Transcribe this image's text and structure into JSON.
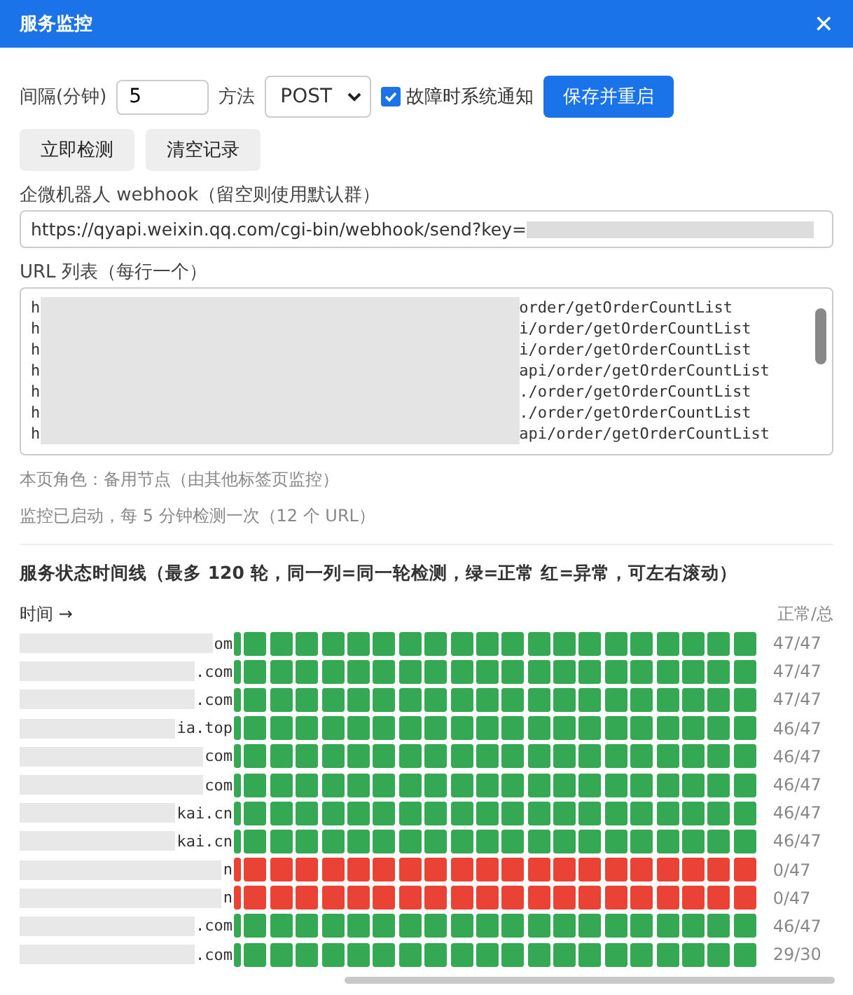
{
  "window": {
    "title": "服务监控",
    "close": "✕"
  },
  "settings": {
    "interval_label": "间隔(分钟)",
    "interval_value": "5",
    "method_label": "方法",
    "method_value": "POST",
    "notify": {
      "label": "故障时系统通知",
      "checked": true
    },
    "save_button": "保存并重启"
  },
  "actions": [
    "立即检测",
    "清空记录"
  ],
  "webhook": {
    "label": "企微机器人 webhook（留空则使用默认群）",
    "value": "https://qyapi.weixin.qq.com/cgi-bin/webhook/send?key="
  },
  "url_list": {
    "label": "URL 列表（每行一个）",
    "lines": [
      {
        "start": "h",
        "end": "order/getOrderCountList"
      },
      {
        "start": "h",
        "end": "i/order/getOrderCountList"
      },
      {
        "start": "h",
        "end": "i/order/getOrderCountList"
      },
      {
        "start": "h",
        "end": "api/order/getOrderCountList"
      },
      {
        "start": "h",
        "end": "./order/getOrderCountList"
      },
      {
        "start": "h",
        "end": "./order/getOrderCountList"
      },
      {
        "start": "h",
        "end": "api/order/getOrderCountList"
      }
    ]
  },
  "role_note": "本页角色：备用节点（由其他标签页监控）",
  "status_note": "监控已启动，每 5 分钟检测一次（12 个 URL）",
  "timeline": {
    "title": "服务状态时间线（最多 120 轮，同一列=同一轮检测，绿=正常 红=异常，可左右滚动）",
    "time_label": "时间 →",
    "ratio_header": "正常/总",
    "rows": [
      {
        "host": "om",
        "healthy": true,
        "ratio": "47/47"
      },
      {
        "host": ".com",
        "healthy": true,
        "ratio": "47/47"
      },
      {
        "host": ".com",
        "healthy": true,
        "ratio": "47/47"
      },
      {
        "host": "ia.top",
        "healthy": true,
        "ratio": "46/47"
      },
      {
        "host": "com",
        "healthy": true,
        "ratio": "46/47"
      },
      {
        "host": "com",
        "healthy": true,
        "ratio": "46/47"
      },
      {
        "host": "kai.cn",
        "healthy": true,
        "ratio": "46/47"
      },
      {
        "host": "kai.cn",
        "healthy": true,
        "ratio": "46/47"
      },
      {
        "host": "n",
        "healthy": false,
        "ratio": "0/47"
      },
      {
        "host": "n",
        "healthy": false,
        "ratio": "0/47"
      },
      {
        "host": ".com",
        "healthy": true,
        "ratio": "46/47"
      },
      {
        "host": ".com",
        "healthy": true,
        "ratio": "29/30"
      }
    ]
  }
}
